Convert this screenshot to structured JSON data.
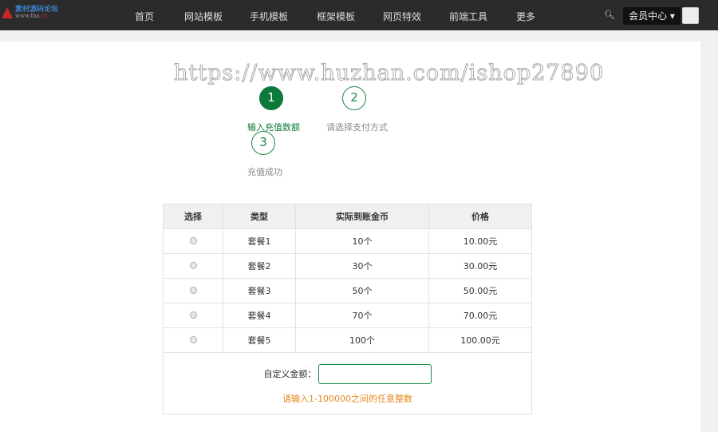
{
  "nav": {
    "logo_text": "素材源码论坛",
    "logo_url_a": "www.fna",
    "logo_url_b": ".cc",
    "items": [
      "首页",
      "网站模板",
      "手机模板",
      "框架模板",
      "网页特效",
      "前端工具",
      "更多"
    ],
    "member": "会员中心"
  },
  "watermark": "https://www.huzhan.com/ishop27890",
  "steps": [
    {
      "num": "1",
      "label": "输入充值数额"
    },
    {
      "num": "2",
      "label": "请选择支付方式"
    },
    {
      "num": "3",
      "label": "充值成功"
    }
  ],
  "table": {
    "headers": [
      "选择",
      "类型",
      "实际到账金币",
      "价格"
    ],
    "rows": [
      [
        "套餐1",
        "10个",
        "10.00元"
      ],
      [
        "套餐2",
        "30个",
        "30.00元"
      ],
      [
        "套餐3",
        "50个",
        "50.00元"
      ],
      [
        "套餐4",
        "70个",
        "70.00元"
      ],
      [
        "套餐5",
        "100个",
        "100.00元"
      ]
    ],
    "custom_label": "自定义金额：",
    "custom_value": "",
    "hint": "请输入1-100000之间的任意整数"
  },
  "colors": {
    "accent": "#0b7a3a",
    "hint": "#e8871e"
  }
}
